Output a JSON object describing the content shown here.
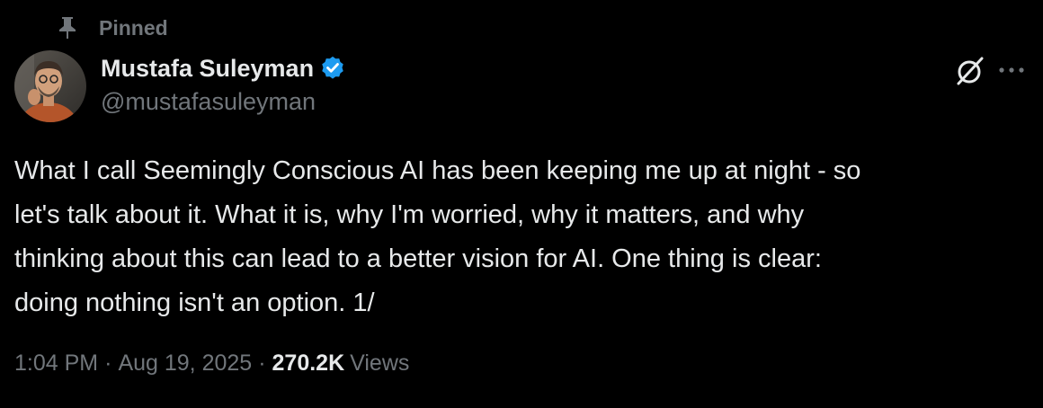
{
  "pinned": {
    "label": "Pinned",
    "icon": "pin-icon"
  },
  "author": {
    "display_name": "Mustafa Suleyman",
    "handle": "@mustafasuleyman",
    "verified_icon": "verified-badge-icon",
    "verified_color": "#1d9bf0"
  },
  "actions": {
    "grok_icon": "grok-icon",
    "more_icon": "more-icon"
  },
  "tweet": {
    "text_lines": [
      "What I call Seemingly Conscious AI has been keeping me up at night - so",
      "let's talk about it. What it is, why I'm worried, why it matters, and why",
      "thinking about this can lead to a better vision for AI. One thing is clear:",
      "doing nothing isn't an option. 1/"
    ]
  },
  "meta": {
    "time": "1:04 PM",
    "separator": "·",
    "date": "Aug 19, 2025",
    "views_count": "270.2K",
    "views_label": "Views"
  },
  "colors": {
    "background": "#000000",
    "primary_text": "#e7e9ea",
    "secondary_text": "#71767b",
    "accent": "#1d9bf0"
  }
}
